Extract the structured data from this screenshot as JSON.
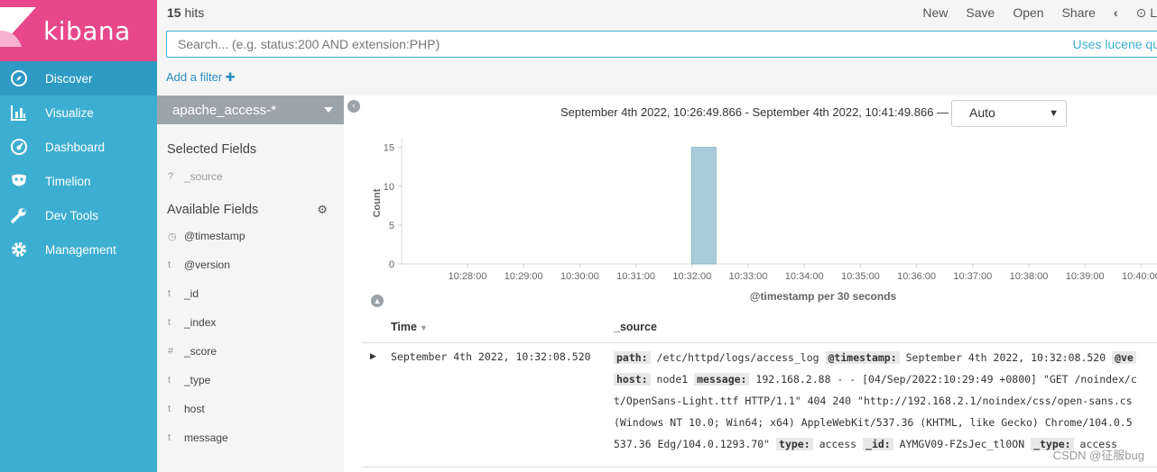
{
  "brand": {
    "name": "kibana",
    "color_pink": "#e8488b",
    "color_sidebar": "#3caed2"
  },
  "nav": [
    {
      "label": "Discover",
      "icon": "compass-icon",
      "active": true
    },
    {
      "label": "Visualize",
      "icon": "bar-chart-icon"
    },
    {
      "label": "Dashboard",
      "icon": "dashboard-gauge-icon"
    },
    {
      "label": "Timelion",
      "icon": "timelion-mask-icon"
    },
    {
      "label": "Dev Tools",
      "icon": "wrench-icon"
    },
    {
      "label": "Management",
      "icon": "gear-icon"
    }
  ],
  "topbar": {
    "hits_count": "15",
    "hits_label": "hits",
    "menu": {
      "new": "New",
      "save": "Save",
      "open": "Open",
      "share": "Share",
      "prev": "‹",
      "clock": "⊙ L"
    }
  },
  "search": {
    "placeholder": "Search... (e.g. status:200 AND extension:PHP)",
    "lucene_link": "Uses lucene qu"
  },
  "filter": {
    "add_label": "Add a filter"
  },
  "fields_panel": {
    "index_pattern": "apache_access-*",
    "selected_title": "Selected Fields",
    "selected": [
      {
        "type": "?",
        "name": "_source"
      }
    ],
    "available_title": "Available Fields",
    "available": [
      {
        "type": "◷",
        "name": "@timestamp"
      },
      {
        "type": "t",
        "name": "@version"
      },
      {
        "type": "t",
        "name": "_id"
      },
      {
        "type": "t",
        "name": "_index"
      },
      {
        "type": "#",
        "name": "_score"
      },
      {
        "type": "t",
        "name": "_type"
      },
      {
        "type": "t",
        "name": "host"
      },
      {
        "type": "t",
        "name": "message"
      }
    ]
  },
  "time_range": {
    "text": "September 4th 2022, 10:26:49.866 - September 4th 2022, 10:41:49.866 —",
    "interval": "Auto"
  },
  "chart_data": {
    "type": "bar",
    "ylabel": "Count",
    "xlabel": "@timestamp per 30 seconds",
    "ylim": [
      0,
      16
    ],
    "yticks": [
      0,
      5,
      10,
      15
    ],
    "x_ticks": [
      "10:28:00",
      "10:29:00",
      "10:30:00",
      "10:31:00",
      "10:32:00",
      "10:33:00",
      "10:34:00",
      "10:35:00",
      "10:36:00",
      "10:37:00",
      "10:38:00",
      "10:39:00",
      "10:40:00"
    ],
    "bars": [
      {
        "x": "10:32:00",
        "value": 15
      }
    ],
    "bar_color": "#a8cdd9"
  },
  "table": {
    "col_time": "Time",
    "col_source": "_source",
    "rows": [
      {
        "time": "September 4th 2022, 10:32:08.520",
        "source_lines": [
          [
            {
              "k": "path:"
            },
            {
              "v": " /etc/httpd/logs/access_log "
            },
            {
              "k": "@timestamp:"
            },
            {
              "v": " September 4th 2022, 10:32:08.520 "
            },
            {
              "k": "@ve"
            }
          ],
          [
            {
              "k": "host:"
            },
            {
              "v": " node1 "
            },
            {
              "k": "message:"
            },
            {
              "v": " 192.168.2.88 - - [04/Sep/2022:10:29:49 +0800] \"GET /noindex/c"
            }
          ],
          [
            {
              "v": "t/OpenSans-Light.ttf HTTP/1.1\" 404 240 \"http://192.168.2.1/noindex/css/open-sans.cs"
            }
          ],
          [
            {
              "v": "(Windows NT 10.0; Win64; x64) AppleWebKit/537.36 (KHTML, like Gecko) Chrome/104.0.5"
            }
          ],
          [
            {
              "v": "537.36 Edg/104.0.1293.70\" "
            },
            {
              "k": "type:"
            },
            {
              "v": " access "
            },
            {
              "k": "_id:"
            },
            {
              "v": " AYMGV09-FZsJec_tl0ON "
            },
            {
              "k": "_type:"
            },
            {
              "v": " access "
            }
          ]
        ]
      }
    ]
  },
  "watermark": "CSDN @征服bug"
}
